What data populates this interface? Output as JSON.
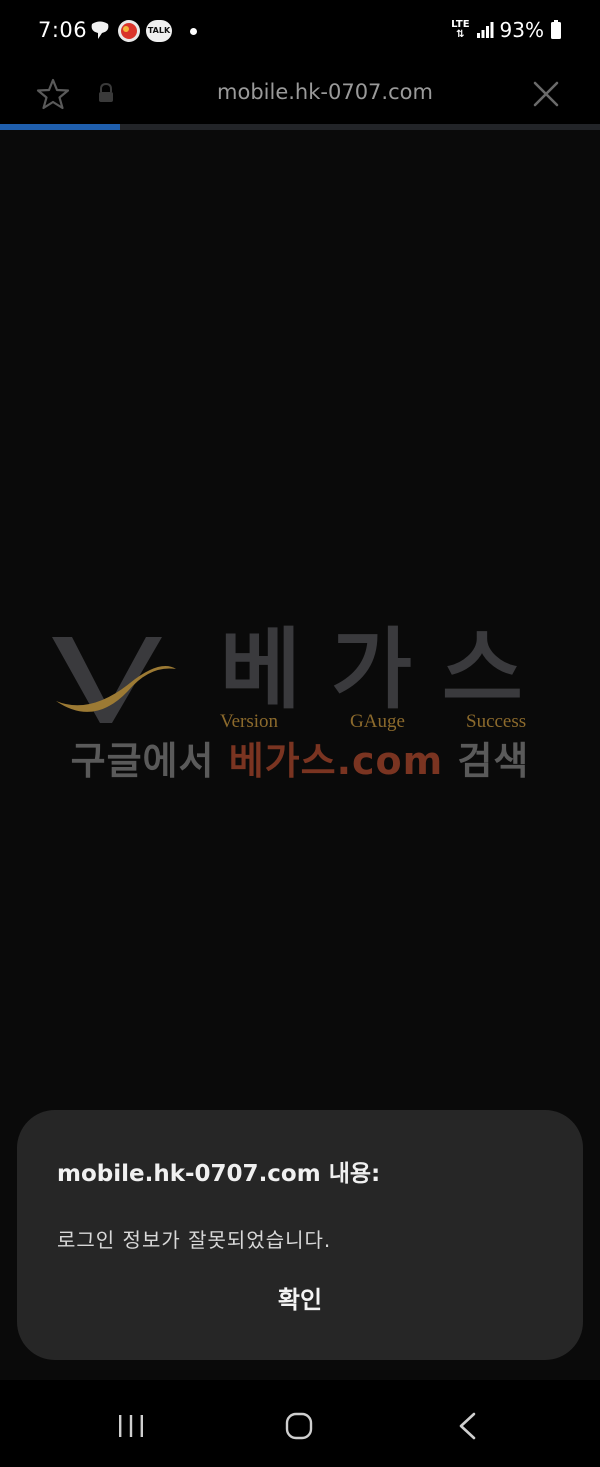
{
  "status_bar": {
    "time": "7:06",
    "notification_icons": [
      "chat-bubble-icon",
      "app-badge-icon",
      "kakaotalk-icon",
      "dot-icon"
    ],
    "kakaotalk_label": "TALK",
    "network": "LTE",
    "battery_percent": "93%"
  },
  "browser": {
    "url": "mobile.hk-0707.com",
    "load_progress": 0.2
  },
  "page": {
    "logo_korean": "베가스",
    "logo_sub": [
      "Version",
      "GAuge",
      "Success"
    ],
    "promo_prefix": "구글에서 ",
    "promo_highlight": "베가스.com",
    "promo_suffix": " 검색"
  },
  "dialog": {
    "title": "mobile.hk-0707.com 내용:",
    "message": "로그인 정보가 잘못되었습니다.",
    "ok_label": "확인"
  },
  "colors": {
    "progress": "#1f5fae",
    "dialog_bg": "#262626",
    "promo_accent": "#7a3421",
    "logo_gold": "#8c6a2c"
  }
}
